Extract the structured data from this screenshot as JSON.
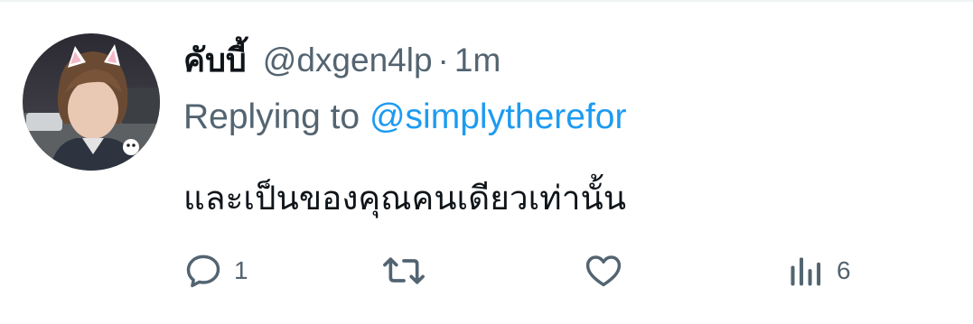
{
  "tweet": {
    "display_name": "คับบี้",
    "handle": "@dxgen4lp",
    "separator": "·",
    "time": "1m",
    "replying_prefix": "Replying to",
    "replying_to": "@simplytherefor",
    "text": "และเป็นของคุณคนเดียวเท่านั้น"
  },
  "actions": {
    "reply": {
      "icon": "reply-icon",
      "count": "1"
    },
    "retweet": {
      "icon": "retweet-icon",
      "count": ""
    },
    "like": {
      "icon": "heart-icon",
      "count": ""
    },
    "views": {
      "icon": "views-icon",
      "count": "6"
    }
  },
  "colors": {
    "text_primary": "#0f1419",
    "text_secondary": "#536471",
    "link": "#1d9bf0"
  }
}
